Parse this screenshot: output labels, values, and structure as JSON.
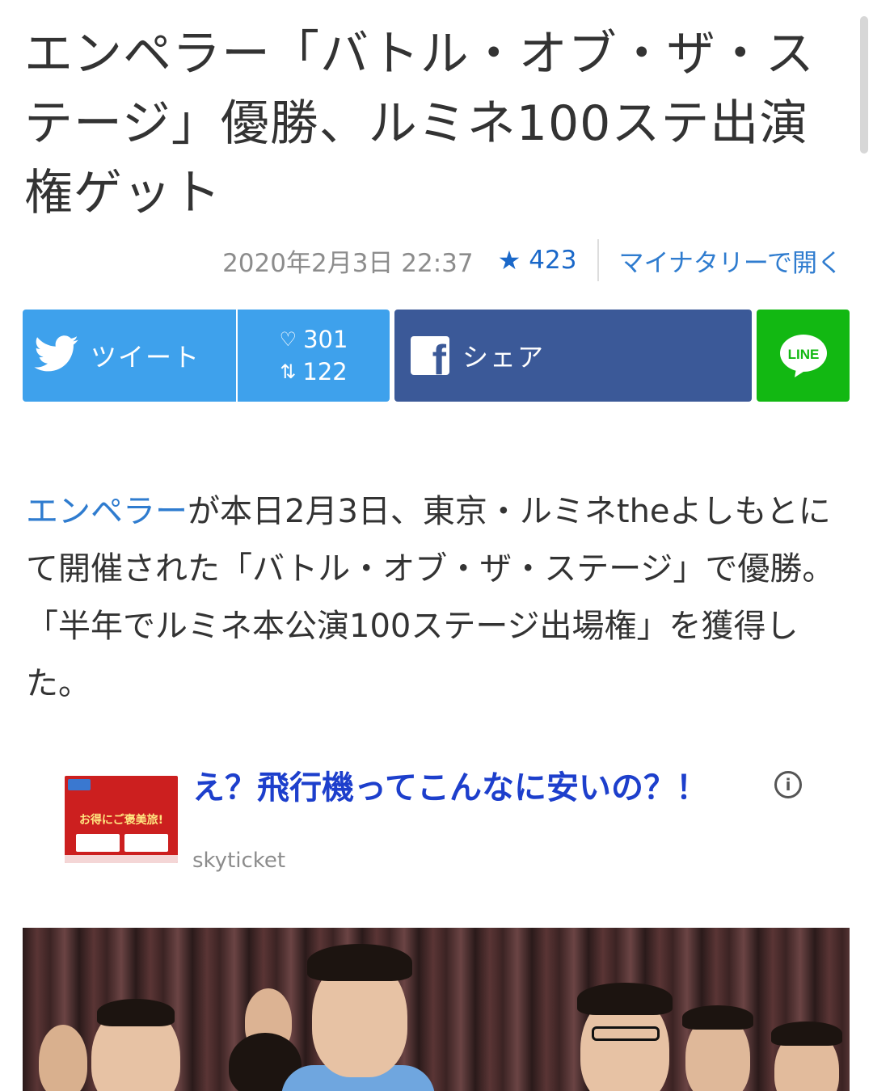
{
  "article": {
    "title": "エンペラー「バトル・オブ・ザ・ステージ」優勝、ルミネ100ステ出演権ゲット",
    "date": "2020年2月3日 22:37",
    "star_count": "423",
    "open_in_app": "マイナタリーで開く",
    "body_link": "エンペラー",
    "body_text": "が本日2月3日、東京・ルミネtheよしもとにて開催された「バトル・オブ・ザ・ステージ」で優勝。「半年でルミネ本公演100ステージ出場権」を獲得した。"
  },
  "share": {
    "tweet_label": "ツイート",
    "likes": "301",
    "retweets": "122",
    "facebook_label": "シェア",
    "line_label": "LINE"
  },
  "ad": {
    "title": "え？飛行機ってこんなに安いの？！",
    "source": "skyticket",
    "thumb_text": "お得にご褒美旅!"
  },
  "icons": {
    "star": "star-icon",
    "twitter": "twitter-bird-icon",
    "heart": "heart-icon",
    "retweet": "retweet-icon",
    "facebook": "facebook-logo-icon",
    "line": "line-logo-icon",
    "info": "info-icon"
  },
  "colors": {
    "twitter": "#3ea1ec",
    "facebook": "#3b5998",
    "line": "#12b812",
    "link": "#2f7ccf",
    "ad_title": "#1d3fcc"
  }
}
